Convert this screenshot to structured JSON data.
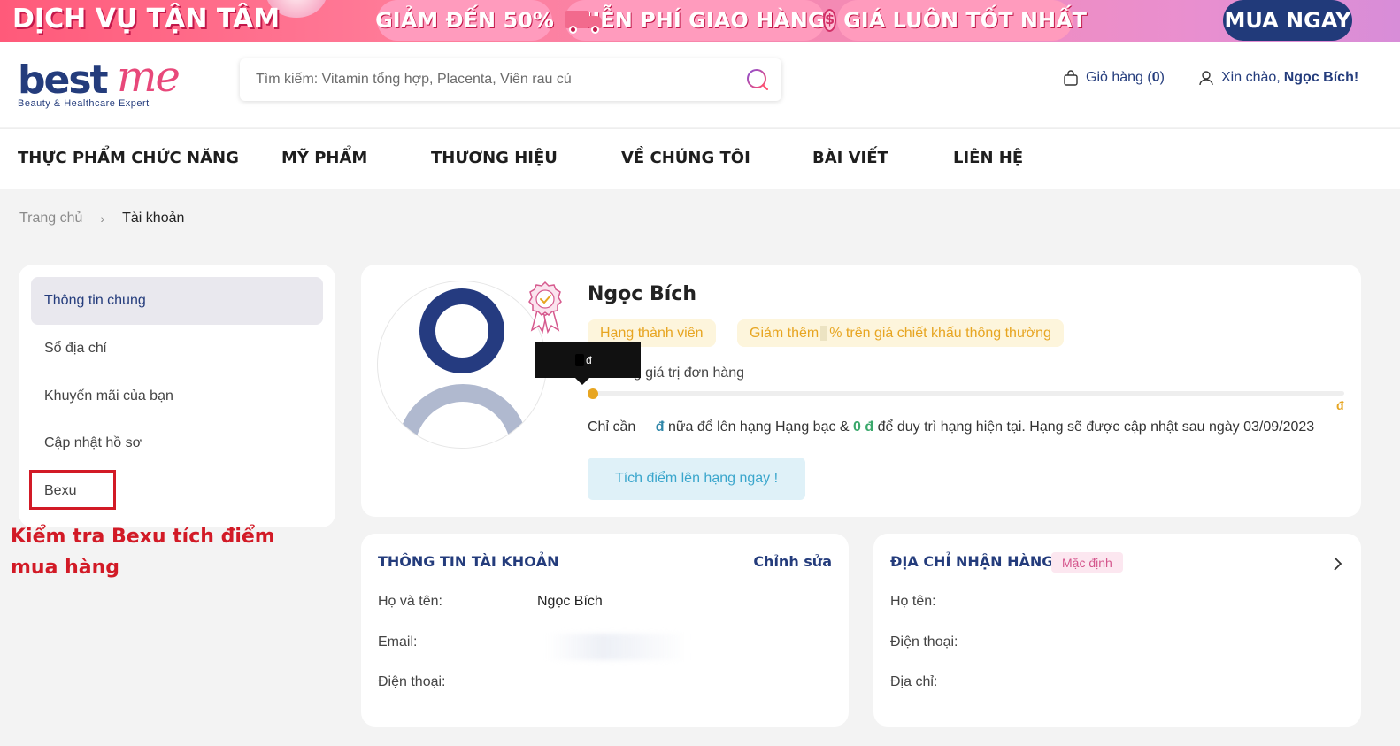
{
  "promo": {
    "slogan": "DỊCH VỤ TẬN TÂM",
    "discount": "GIẢM ĐẾN 50%",
    "shipping": "MIỄN PHÍ GIAO HÀNG",
    "price": "GIÁ LUÔN TỐT NHẤT",
    "cta": "MUA NGAY"
  },
  "header": {
    "logo_best": "best",
    "logo_me": "me",
    "logo_tagline": "Beauty & Healthcare Expert",
    "search_placeholder": "Tìm kiếm: Vitamin tổng hợp, Placenta, Viên rau củ",
    "cart_label": "Giỏ hàng (",
    "cart_count": "0",
    "cart_close": ")",
    "greeting": "Xin chào,",
    "user_name": "Ngọc Bích!"
  },
  "nav": [
    "THỰC PHẨM CHỨC NĂNG",
    "MỸ PHẨM",
    "THƯƠNG HIỆU",
    "VỀ CHÚNG TÔI",
    "BÀI VIẾT",
    "LIÊN HỆ"
  ],
  "breadcrumb": {
    "home": "Trang chủ",
    "sep": "›",
    "current": "Tài khoản"
  },
  "sidebar": [
    "Thông tin chung",
    "Sổ địa chỉ",
    "Khuyến mãi của bạn",
    "Cập nhật hồ sơ",
    "Bexu"
  ],
  "annotation": "Kiểm tra Bexu tích điểm mua hàng",
  "profile": {
    "name": "Ngọc Bích",
    "rank_tag": "Hạng thành viên",
    "discount_prefix": "Giảm thêm ",
    "discount_suffix": "% trên giá chiết khấu thông thường",
    "tooltip_currency": "đ",
    "order_label": "ổng giá trị đơn hàng",
    "progress": 0,
    "end_currency": "đ",
    "note_prefix": "Chỉ cần",
    "note_currency": "đ",
    "note_middle": "nữa để lên hạng Hạng bạc &",
    "note_maintain": "0 đ",
    "note_suffix": "để duy trì hạng hiện tại. Hạng sẽ được cập nhật sau ngày 03/09/2023",
    "cta": "Tích điểm lên hạng ngay !"
  },
  "account_card": {
    "title": "THÔNG TIN TÀI KHOẢN",
    "action": "Chỉnh sửa",
    "fullname_label": "Họ và tên:",
    "fullname_value": "Ngọc Bích",
    "email_label": "Email:",
    "phone_label": "Điện thoại:"
  },
  "address_card": {
    "title": "ĐỊA CHỈ NHẬN HÀNG",
    "badge": "Mặc định",
    "name_label": "Họ tên:",
    "phone_label": "Điện thoại:",
    "address_label": "Địa chỉ:"
  },
  "colors": {
    "brand_navy": "#243c7c",
    "brand_pink": "#e8487a",
    "gold": "#e7a521",
    "annotation_red": "#d21a26"
  }
}
